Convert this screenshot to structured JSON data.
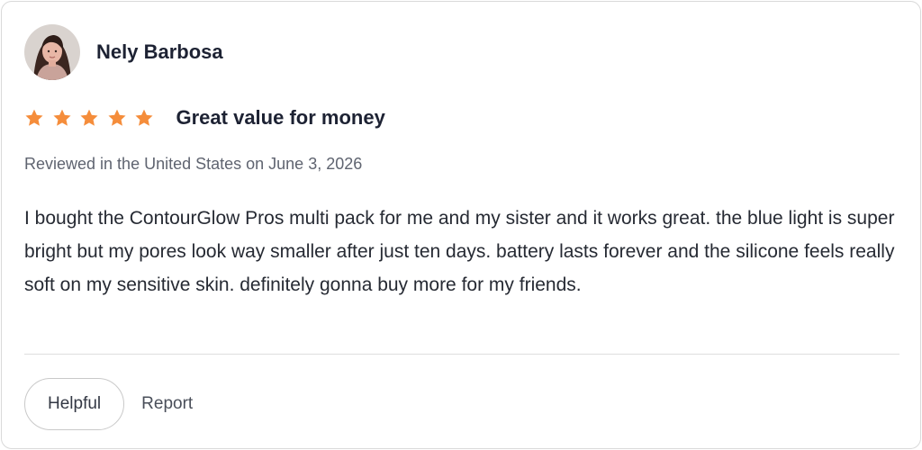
{
  "reviewer": {
    "name": "Nely Barbosa"
  },
  "review": {
    "rating": 5,
    "rating_max": 5,
    "star_color": "#f58d3b",
    "title": "Great value for money",
    "meta": "Reviewed in the United States on June 3, 2026",
    "body": "I bought the ContourGlow Pros multi pack for me and my sister and it works great. the blue light is super bright but my pores look way smaller after just ten days. battery lasts forever and the silicone feels really soft on my sensitive skin. definitely gonna buy more for my friends."
  },
  "actions": {
    "helpful_label": "Helpful",
    "report_label": "Report"
  },
  "icons": {
    "avatar": "avatar",
    "star": "star-icon"
  }
}
